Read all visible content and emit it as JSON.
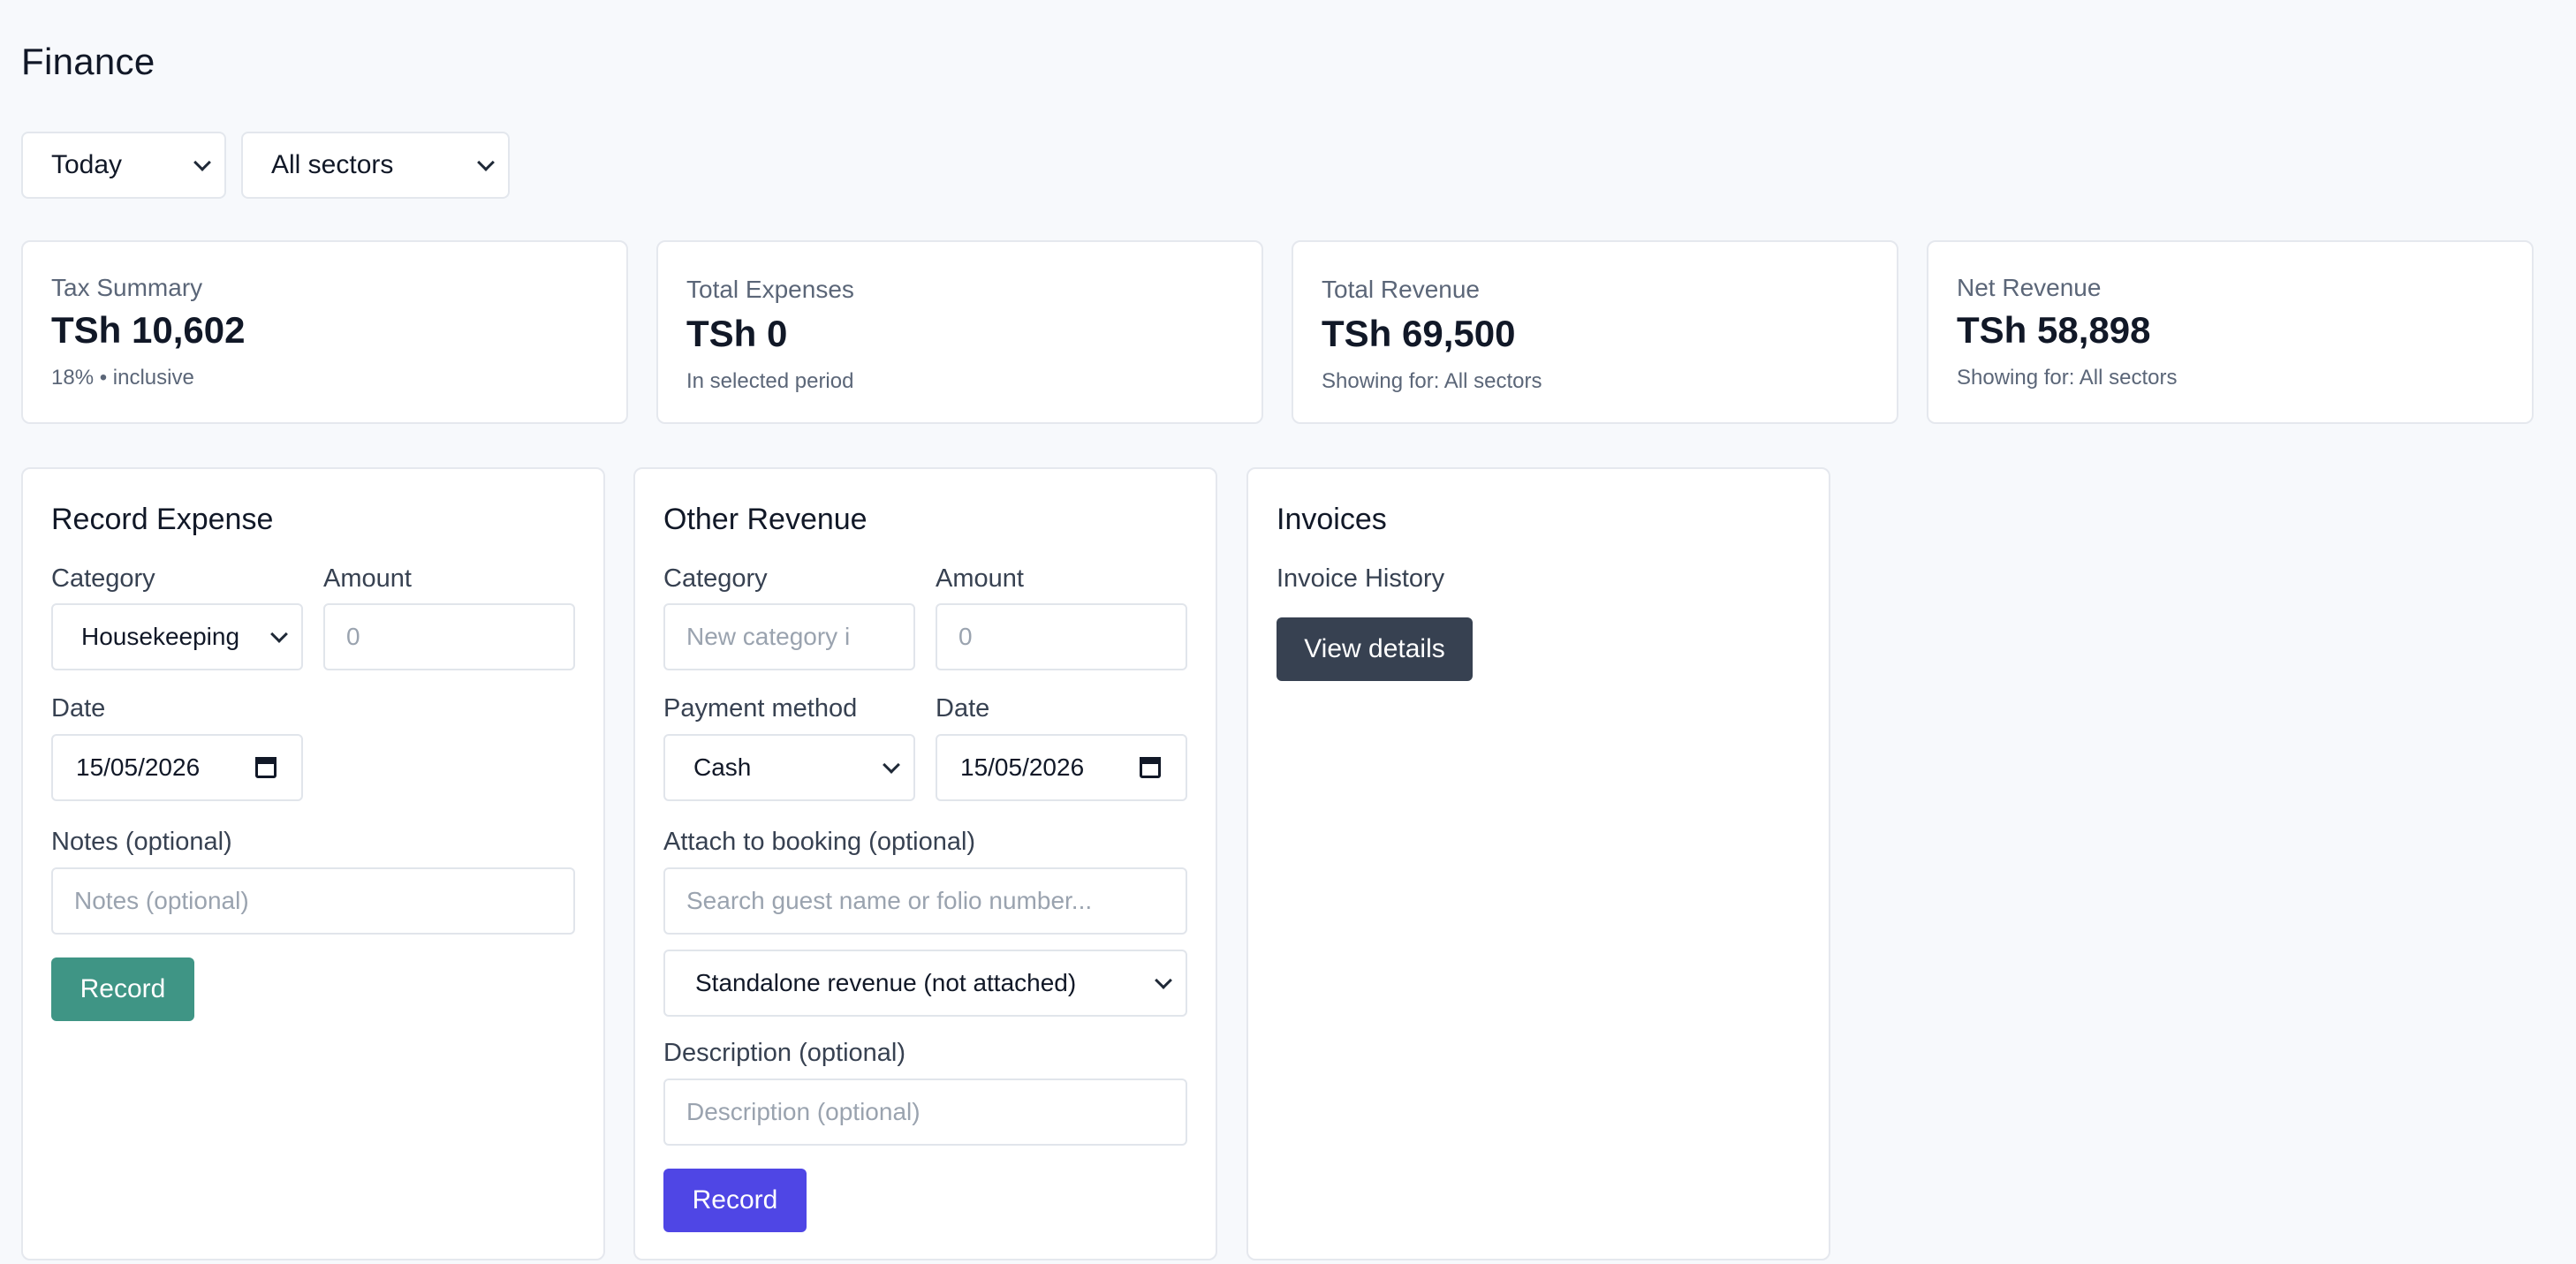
{
  "page": {
    "title": "Finance"
  },
  "filters": {
    "period": "Today",
    "sector": "All sectors"
  },
  "stats": [
    {
      "label": "Tax Summary",
      "value": "TSh 10,602",
      "sub": "18% • inclusive"
    },
    {
      "label": "Total Expenses",
      "value": "TSh 0",
      "sub": "In selected period"
    },
    {
      "label": "Total Revenue",
      "value": "TSh 69,500",
      "sub": "Showing for: All sectors"
    },
    {
      "label": "Net Revenue",
      "value": "TSh 58,898",
      "sub": "Showing for: All sectors"
    }
  ],
  "expense": {
    "title": "Record Expense",
    "category_label": "Category",
    "category_value": "Housekeeping",
    "amount_label": "Amount",
    "amount_placeholder": "0",
    "date_label": "Date",
    "date_value": "15/05/2026",
    "notes_label": "Notes (optional)",
    "notes_placeholder": "Notes (optional)",
    "button": "Record"
  },
  "revenue": {
    "title": "Other Revenue",
    "category_label": "Category",
    "category_placeholder": "New category i",
    "amount_label": "Amount",
    "amount_placeholder": "0",
    "payment_label": "Payment method",
    "payment_value": "Cash",
    "date_label": "Date",
    "date_value": "15/05/2026",
    "attach_label": "Attach to booking (optional)",
    "attach_placeholder": "Search guest name or folio number...",
    "attach_select": "Standalone revenue (not attached)",
    "description_label": "Description (optional)",
    "description_placeholder": "Description (optional)",
    "button": "Record"
  },
  "invoices": {
    "title": "Invoices",
    "history_label": "Invoice History",
    "button": "View details"
  },
  "colors": {
    "expense_button": "#3f9585",
    "revenue_button": "#4f46e5",
    "invoice_button": "#374151"
  }
}
